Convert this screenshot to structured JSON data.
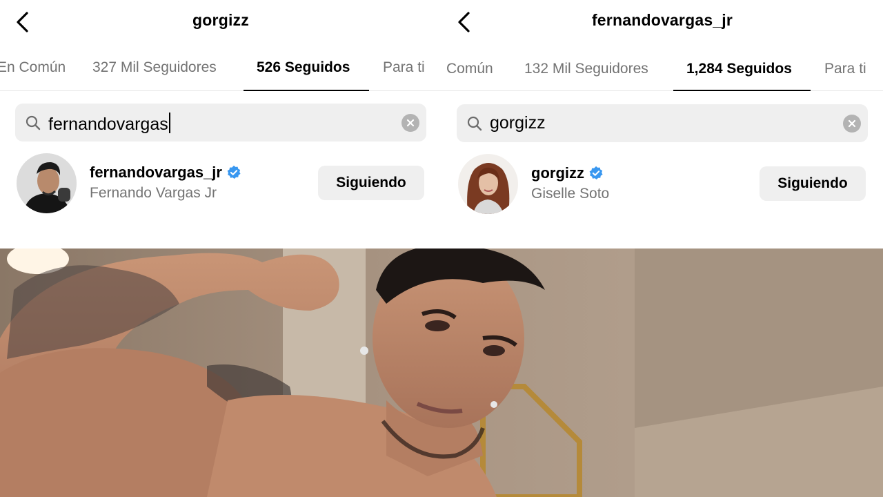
{
  "left_panel": {
    "title": "gorgizz",
    "tabs": [
      {
        "label": "En Común"
      },
      {
        "label": "327 Mil Seguidores"
      },
      {
        "label": "526 Seguidos"
      },
      {
        "label": "Para ti"
      }
    ],
    "active_tab": "526 Seguidos",
    "search": {
      "value": "fernandovargas"
    },
    "result": {
      "username": "fernandovargas_jr",
      "full_name": "Fernando Vargas Jr",
      "verified": true,
      "button_label": "Siguiendo"
    }
  },
  "right_panel": {
    "title": "fernandovargas_jr",
    "tabs": [
      {
        "label": "Común"
      },
      {
        "label": "132 Mil Seguidores"
      },
      {
        "label": "1,284 Seguidos"
      },
      {
        "label": "Para ti"
      }
    ],
    "active_tab": "1,284 Seguidos",
    "search": {
      "value": "gorgizz"
    },
    "result": {
      "username": "gorgizz",
      "full_name": "Giselle Soto",
      "verified": true,
      "button_label": "Siguiendo"
    }
  },
  "icons": {
    "back": "chevron-left-icon",
    "search": "search-icon",
    "clear": "clear-circle-icon",
    "verified": "verified-badge-icon"
  },
  "colors": {
    "verified_blue": "#3897f0",
    "secondary_text": "#737373",
    "input_bg": "#efefef"
  }
}
